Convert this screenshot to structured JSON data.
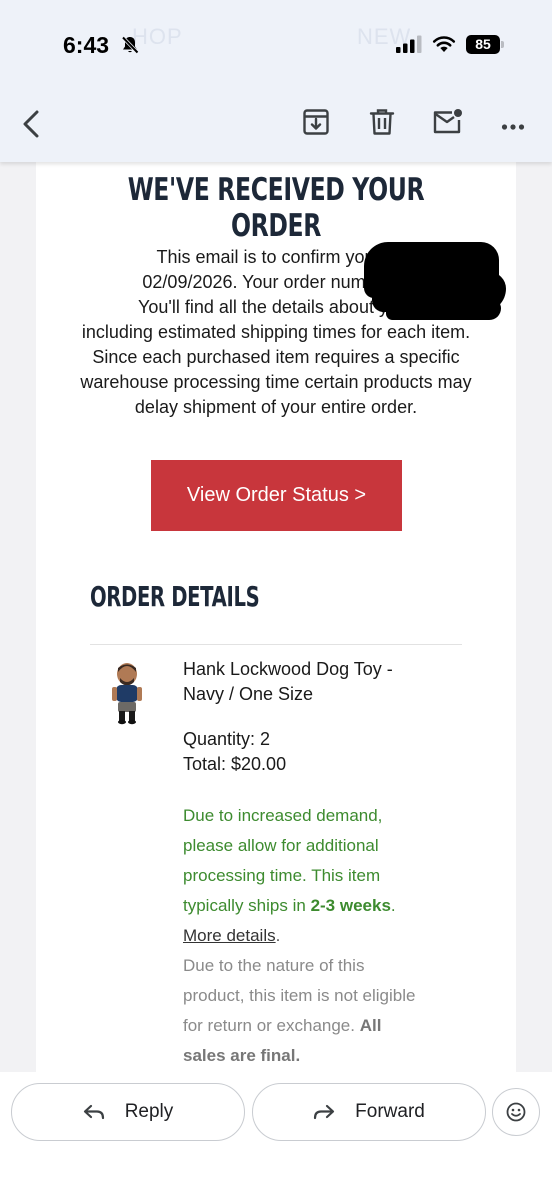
{
  "status_bar": {
    "time": "6:43",
    "battery": "85",
    "ghost_left": "HOP",
    "ghost_right": "NEW"
  },
  "toolbar": {
    "icons": [
      "back-arrow-icon",
      "archive-icon",
      "trash-icon",
      "mark-unread-icon",
      "more-icon"
    ]
  },
  "email": {
    "headline": "WE'VE RECEIVED YOUR ORDER",
    "paragraph": {
      "line1": "This email is to confirm your o",
      "line2": "02/09/2026. Your order number is",
      "line3": "You'll find all the details about your",
      "line4": "including estimated shipping times for each item.",
      "line5": "Since each purchased item requires a specific",
      "line6": "warehouse processing time certain products may",
      "line7": "delay shipment of your entire order."
    },
    "cta_label": "View Order Status >",
    "order_details_title": "ORDER DETAILS",
    "item": {
      "name_line1": "Hank Lockwood Dog Toy -",
      "name_line2": "Navy / One Size",
      "quantity": "Quantity: 2",
      "total": "Total: $20.00",
      "notice_1": "Due to increased demand,",
      "notice_2": "please allow for additional",
      "notice_3": "processing time. This item",
      "notice_4": "typically ships in ",
      "notice_bold": "2-3 weeks",
      "notice_end": ".",
      "more_link": "More details",
      "more_end": ".",
      "final_1": "Due to the nature of this",
      "final_2": "product, this item is not eligible",
      "final_3": "for return or exchange. ",
      "final_bold_1": "All",
      "final_bold_2": "sales are final."
    }
  },
  "actions": {
    "reply": "Reply",
    "forward": "Forward"
  },
  "colors": {
    "accent_red": "#c8363c",
    "headline_navy": "#1d2838",
    "notice_green": "#3d8b2f",
    "toolbar_bg": "#eef2f9"
  }
}
